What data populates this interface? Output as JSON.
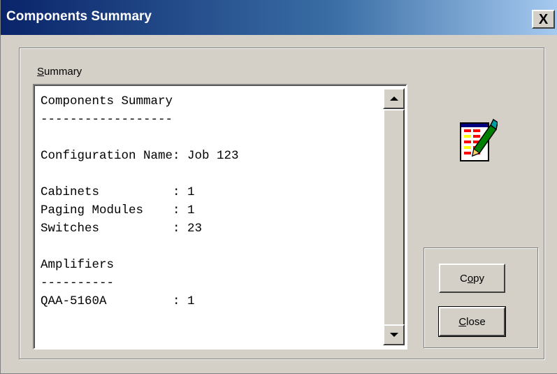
{
  "window": {
    "title": "Components Summary",
    "close_glyph": "X"
  },
  "summary": {
    "label_accel": "S",
    "label_rest": "ummary",
    "lines": [
      "Components Summary",
      "------------------",
      "",
      "Configuration Name: Job 123",
      "",
      "Cabinets          : 1",
      "Paging Modules    : 1",
      "Switches          : 23",
      "",
      "Amplifiers",
      "----------",
      "QAA-5160A         : 1"
    ]
  },
  "icon": {
    "name": "edit-document-icon"
  },
  "buttons": {
    "copy_pre": "C",
    "copy_accel": "o",
    "copy_post": "py",
    "close_pre": "",
    "close_accel": "C",
    "close_post": "lose"
  },
  "colors": {
    "titlebar_start": "#0a246a",
    "titlebar_end": "#a6caf0",
    "face": "#d4d0c8"
  }
}
